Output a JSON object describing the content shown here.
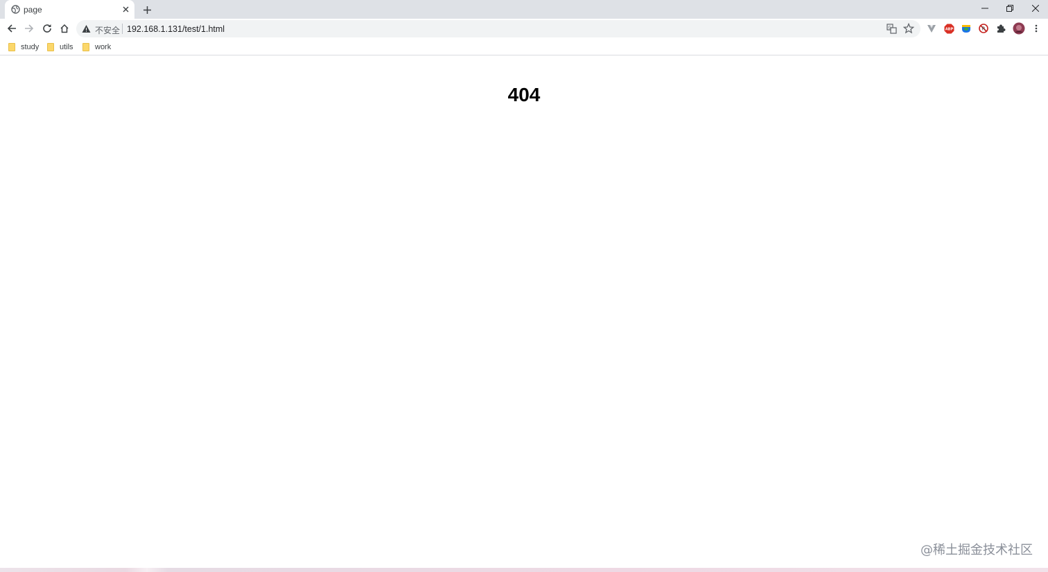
{
  "tab": {
    "title": "page",
    "favicon_icon": "globe-icon",
    "close_icon": "close-icon"
  },
  "newtab_icon": "plus-icon",
  "window_controls": [
    "minimize-icon",
    "restore-icon",
    "close-icon"
  ],
  "toolbar": {
    "back_icon": "arrow-left-icon",
    "forward_icon": "arrow-right-icon",
    "reload_icon": "reload-icon",
    "home_icon": "home-icon",
    "security_label": "不安全",
    "url": "192.168.1.131/test/1.html",
    "translate_icon": "translate-icon",
    "bookmark_icon": "star-icon",
    "extensions": [
      "vue-devtools-icon",
      "adblock-icon",
      "bookmark-ext-icon",
      "block-ext-icon",
      "puzzle-icon"
    ],
    "profile_icon": "avatar",
    "menu_icon": "more-vert-icon"
  },
  "bookmarks": [
    {
      "label": "study"
    },
    {
      "label": "utils"
    },
    {
      "label": "work"
    }
  ],
  "content": {
    "heading": "404",
    "watermark": "@稀土掘金技术社区"
  },
  "colors": {
    "tabstrip": "#dee1e6",
    "omnibox": "#f1f3f4",
    "folder": "#fbd76b",
    "adblock": "#d93025"
  }
}
